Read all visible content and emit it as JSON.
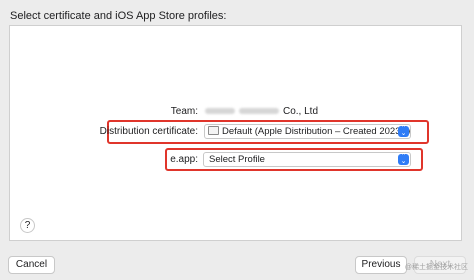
{
  "header": {
    "text": "Select certificate and iOS App Store profiles:"
  },
  "form": {
    "team_label": "Team:",
    "team_value": "Co., Ltd",
    "distribution_label": "Distribution certificate:",
    "distribution_value": "Default (Apple Distribution – Created 2023/4/...",
    "app_label": "e.app:",
    "app_value": "Select Profile"
  },
  "footer": {
    "help_label": "?",
    "cancel_label": "Cancel",
    "previous_label": "Previous",
    "next_label": "Next"
  },
  "watermark": "@稀土掘金技术社区",
  "icons": {
    "certificate": "certificate-icon",
    "stepper": "popup-stepper-icon"
  },
  "colors": {
    "highlight": "#e0352b",
    "accent": "#2f7cf6"
  }
}
